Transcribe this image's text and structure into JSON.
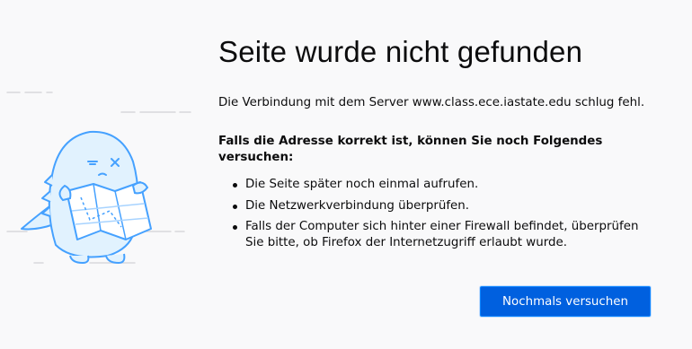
{
  "error": {
    "title": "Seite wurde nicht gefunden",
    "description": "Die Verbindung mit dem Server www.class.ece.iastate.edu schlug fehl.",
    "try_heading": "Falls die Adresse korrekt ist, können Sie noch Folgendes versuchen:",
    "suggestions": [
      "Die Seite später noch einmal aufrufen.",
      "Die Netzwerkverbindung überprüfen.",
      "Falls der Computer sich hinter einer Firewall befindet, überprüfen Sie bitte, ob Firefox der Internetzugriff erlaubt wurde."
    ],
    "retry_label": "Nochmals versuchen"
  },
  "illustration": {
    "icon": "lost-dino-with-map-icon",
    "accent_color": "#45a1ff",
    "fill_color": "#e1f2fe"
  },
  "colors": {
    "background": "#f9f9fa",
    "primary_button": "#0060df",
    "text": "#0c0c0d"
  }
}
